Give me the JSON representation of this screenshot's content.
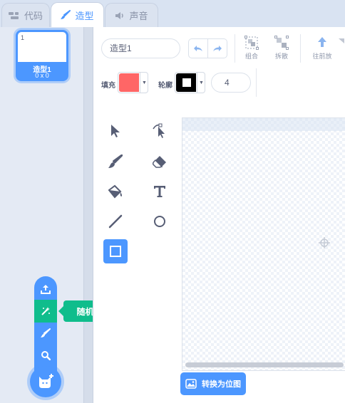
{
  "tabs": [
    {
      "label": "代码",
      "icon": "code-blocks-icon",
      "active": false
    },
    {
      "label": "造型",
      "icon": "paintbrush-icon",
      "active": true
    },
    {
      "label": "声音",
      "icon": "speaker-icon",
      "active": false
    }
  ],
  "costume_list": {
    "items": [
      {
        "number": "1",
        "name": "造型1",
        "size": "0 x 0",
        "selected": true
      }
    ]
  },
  "add_costume_menu": {
    "items": [
      "upload-icon",
      "surprise-icon",
      "paint-icon",
      "search-icon"
    ],
    "highlighted": "surprise-icon",
    "tooltip": "随机",
    "main_icon": "cat-add-icon"
  },
  "editor": {
    "costume_name": "造型1",
    "toolbar": {
      "undo": "undo-icon",
      "redo": "redo-icon",
      "group_label": "组合",
      "ungroup_label": "拆散",
      "forward_label": "往前放"
    },
    "fill_label": "填充",
    "outline_label": "轮廓",
    "fill_color": "#ff6666",
    "outline_color": "#000000",
    "outline_width": "4",
    "tools": [
      "select-icon",
      "reshape-icon",
      "brush-icon",
      "eraser-icon",
      "fill-icon",
      "text-icon",
      "line-icon",
      "circle-icon",
      "rectangle-icon"
    ],
    "selected_tool": "rectangle-icon",
    "convert_button": "转换为位图"
  },
  "colors": {
    "accent": "#4c97ff",
    "highlight": "#0fbd8c"
  }
}
